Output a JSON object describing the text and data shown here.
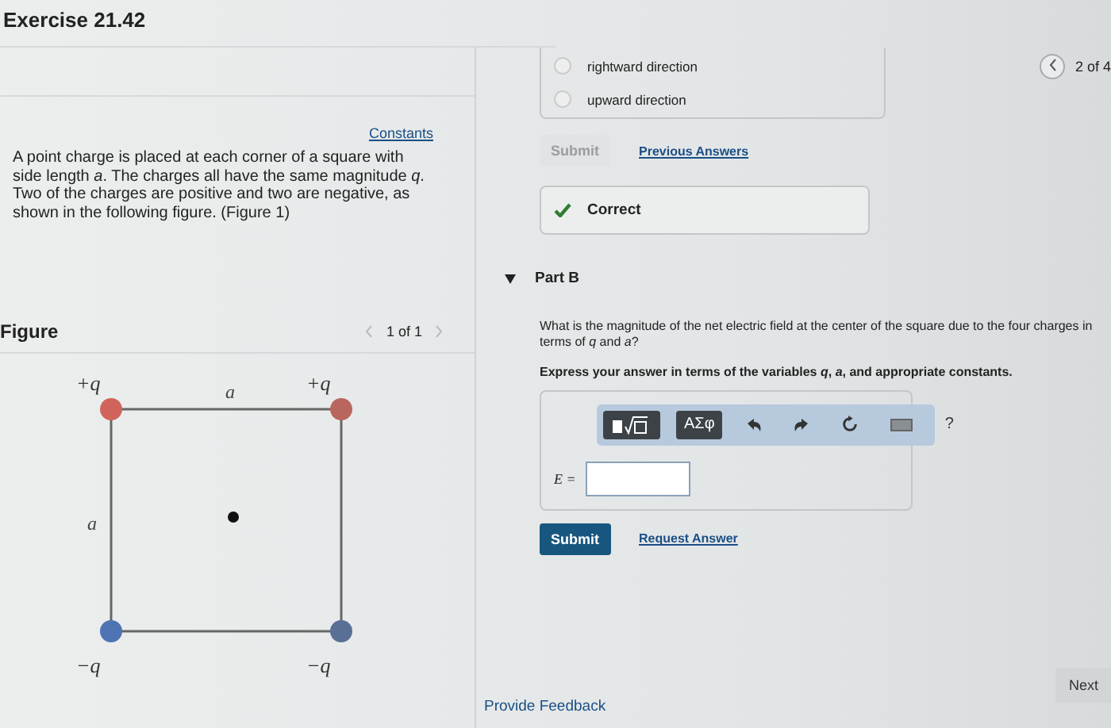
{
  "header": {
    "title": "Exercise 21.42"
  },
  "pager": {
    "label": "2 of 4"
  },
  "problem": {
    "link": "Constants",
    "text": "A point charge is placed at each corner of a square with side length *a*. The charges all have the same magnitude *q*. Two of the charges are positive and two are negative, as shown in the following figure. (Figure 1)"
  },
  "figure": {
    "title": "Figure",
    "pager": "1 of 1",
    "side_labels": [
      "a",
      "a"
    ],
    "charges": [
      {
        "label": "+q",
        "color": "#d0645a"
      },
      {
        "label": "+q",
        "color": "#b8665e"
      },
      {
        "label": "−q",
        "color": "#4f74b4"
      },
      {
        "label": "−q",
        "color": "#5a6f96"
      }
    ]
  },
  "part_a": {
    "options": [
      {
        "label": "rightward direction",
        "selected": false
      },
      {
        "label": "upward direction",
        "selected": false
      }
    ],
    "submit": {
      "label": "Submit",
      "disabled": true
    },
    "link": "Previous Answers",
    "result": "Correct"
  },
  "part_b": {
    "title": "Part B",
    "expanded": true,
    "question": "What is the magnitude of the net electric field at the center of the square due to the four charges in terms of *q* and *a*?",
    "instruction": "Express your answer in terms of the variables *q*, *a*, and appropriate constants.",
    "toolbar": [
      {
        "kind": "templates"
      },
      {
        "kind": "greek",
        "label": "ΑΣφ"
      },
      {
        "kind": "undo"
      },
      {
        "kind": "redo"
      },
      {
        "kind": "reset"
      },
      {
        "kind": "keyboard"
      },
      {
        "kind": "help",
        "label": "?"
      }
    ],
    "variable": "E =",
    "submit": {
      "label": "Submit",
      "disabled": false
    },
    "link": "Request Answer"
  },
  "footer": {
    "feedback": "Provide Feedback",
    "next": "Next"
  }
}
